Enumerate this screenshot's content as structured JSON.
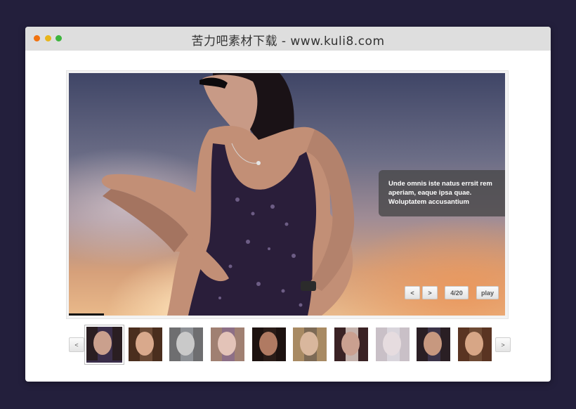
{
  "window": {
    "title": "苦力吧素材下载 - www.kuli8.com"
  },
  "slider": {
    "caption": "Unde omnis iste natus errsit rem aperiam, eaque ipsa quae. Woluptatem accusantium",
    "prev_label": "<",
    "next_label": ">",
    "counter": "4/20",
    "play_label": "play",
    "progress": 0.08
  },
  "thumbnails": {
    "prev_label": "<",
    "next_label": ">",
    "items": [
      {
        "bg": "#3a2e4a",
        "face": "#caa08d",
        "hair": "#2a1e22",
        "active": true
      },
      {
        "bg": "#6b4a36",
        "face": "#d9a98c",
        "hair": "#4a2e1e",
        "active": false
      },
      {
        "bg": "#8e9196",
        "face": "#c9c9c9",
        "hair": "#6e6e70",
        "active": false
      },
      {
        "bg": "#8d6f86",
        "face": "#e3c3b8",
        "hair": "#a08072",
        "active": false
      },
      {
        "bg": "#2a1c18",
        "face": "#b07a62",
        "hair": "#1d1210",
        "active": false
      },
      {
        "bg": "#7d6a55",
        "face": "#d9b79d",
        "hair": "#a88a63",
        "active": false
      },
      {
        "bg": "#c5b3ad",
        "face": "#caa090",
        "hair": "#3a2224",
        "active": false
      },
      {
        "bg": "#d9d5dc",
        "face": "#e6dcdf",
        "hair": "#c9c0c7",
        "active": false
      },
      {
        "bg": "#3b3348",
        "face": "#c7987f",
        "hair": "#2a1f24",
        "active": false
      },
      {
        "bg": "#6e4a34",
        "face": "#d7a686",
        "hair": "#5a3422",
        "active": false
      }
    ]
  }
}
